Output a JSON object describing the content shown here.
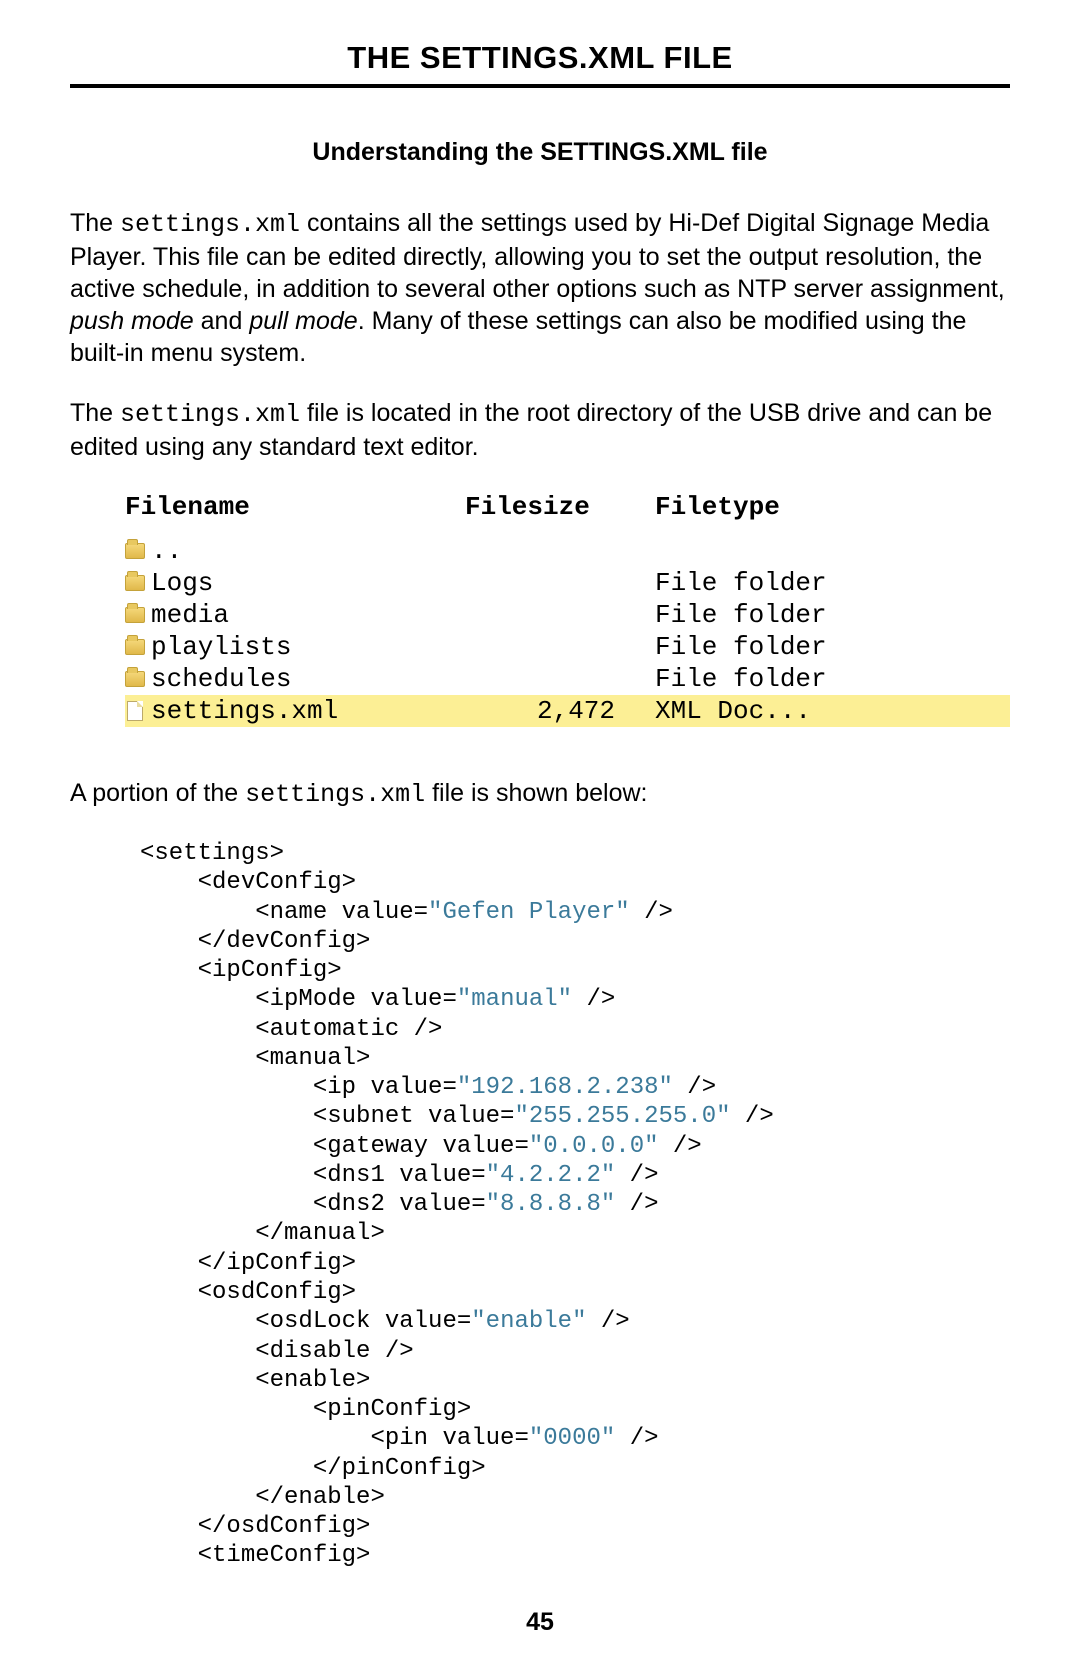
{
  "header": {
    "title": "THE SETTINGS.XML FILE"
  },
  "section": {
    "title": "Understanding the SETTINGS.XML file"
  },
  "para1": {
    "t1": "The ",
    "code1": "settings.xml",
    "t2": " contains all the settings used by Hi-Def Digital Signage Media Player.  This file can be edited directly, allowing you to set the output resolution, the active schedule, in addition to several other options such as NTP server assignment, ",
    "i1": "push mode",
    "t3": " and ",
    "i2": "pull mode",
    "t4": ".  Many of these settings can also be modified using the built-in menu system."
  },
  "para2": {
    "t1": "The ",
    "code1": "settings.xml",
    "t2": " file is located in the root directory of the USB drive and can be edited using any standard text editor."
  },
  "listing": {
    "headers": {
      "name": "Filename",
      "size": "Filesize",
      "type": "Filetype"
    },
    "rows": [
      {
        "icon": "folder",
        "name": "..",
        "size": "",
        "type": "",
        "hl": false
      },
      {
        "icon": "folder",
        "name": "Logs",
        "size": "",
        "type": "File folder",
        "hl": false
      },
      {
        "icon": "folder",
        "name": "media",
        "size": "",
        "type": "File folder",
        "hl": false
      },
      {
        "icon": "folder",
        "name": "playlists",
        "size": "",
        "type": "File folder",
        "hl": false
      },
      {
        "icon": "folder",
        "name": "schedules",
        "size": "",
        "type": "File folder",
        "hl": false
      },
      {
        "icon": "file",
        "name": "settings.xml",
        "size": "2,472",
        "type": "XML Doc...",
        "hl": true
      }
    ]
  },
  "para3": {
    "t1": "A portion of the ",
    "code1": "settings.xml",
    "t2": " file is shown below:"
  },
  "xml": {
    "lines": [
      {
        "i": 0,
        "p": "<settings>"
      },
      {
        "i": 1,
        "p": "<devConfig>"
      },
      {
        "i": 2,
        "p": "<name value=",
        "a": "\"Gefen Player\"",
        "s": " />"
      },
      {
        "i": 1,
        "p": "</devConfig>"
      },
      {
        "i": 1,
        "p": "<ipConfig>"
      },
      {
        "i": 2,
        "p": "<ipMode value=",
        "a": "\"manual\"",
        "s": " />"
      },
      {
        "i": 2,
        "p": "<automatic />"
      },
      {
        "i": 2,
        "p": "<manual>"
      },
      {
        "i": 3,
        "p": "<ip value=",
        "a": "\"192.168.2.238\"",
        "s": " />"
      },
      {
        "i": 3,
        "p": "<subnet value=",
        "a": "\"255.255.255.0\"",
        "s": " />"
      },
      {
        "i": 3,
        "p": "<gateway value=",
        "a": "\"0.0.0.0\"",
        "s": " />"
      },
      {
        "i": 3,
        "p": "<dns1 value=",
        "a": "\"4.2.2.2\"",
        "s": " />"
      },
      {
        "i": 3,
        "p": "<dns2 value=",
        "a": "\"8.8.8.8\"",
        "s": " />"
      },
      {
        "i": 2,
        "p": "</manual>"
      },
      {
        "i": 1,
        "p": "</ipConfig>"
      },
      {
        "i": 1,
        "p": "<osdConfig>"
      },
      {
        "i": 2,
        "p": "<osdLock value=",
        "a": "\"enable\"",
        "s": " />"
      },
      {
        "i": 2,
        "p": "<disable />"
      },
      {
        "i": 2,
        "p": "<enable>"
      },
      {
        "i": 3,
        "p": "<pinConfig>"
      },
      {
        "i": 4,
        "p": "<pin value=",
        "a": "\"0000\"",
        "s": " />"
      },
      {
        "i": 3,
        "p": "</pinConfig>"
      },
      {
        "i": 2,
        "p": "</enable>"
      },
      {
        "i": 1,
        "p": "</osdConfig>"
      },
      {
        "i": 1,
        "p": "<timeConfig>"
      }
    ]
  },
  "page_number": "45"
}
